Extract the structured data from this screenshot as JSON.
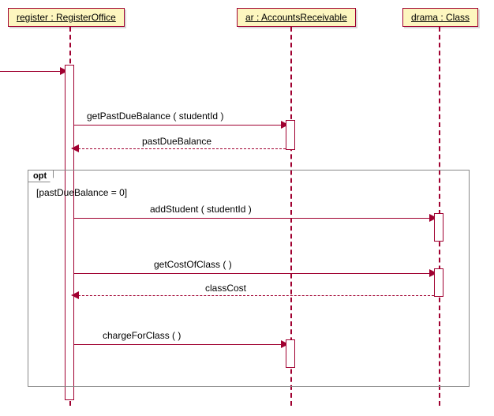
{
  "participants": {
    "register": {
      "label": "register  :  RegisterOffice"
    },
    "ar": {
      "label": "ar  :  AccountsReceivable"
    },
    "drama": {
      "label": "drama  :  Class"
    }
  },
  "fragment": {
    "operator": "opt",
    "guard": "[pastDueBalance = 0]"
  },
  "messages": {
    "m1": {
      "label": "getPastDueBalance ( studentId )"
    },
    "r1": {
      "label": "pastDueBalance"
    },
    "m2": {
      "label": "addStudent ( studentId )"
    },
    "m3": {
      "label": "getCostOfClass  (   )"
    },
    "r3": {
      "label": "classCost"
    },
    "m4": {
      "label": "chargeForClass  (   )"
    }
  },
  "chart_data": {
    "type": "sequence-diagram",
    "participants": [
      {
        "name": "register",
        "type": "RegisterOffice"
      },
      {
        "name": "ar",
        "type": "AccountsReceivable"
      },
      {
        "name": "drama",
        "type": "Class"
      }
    ],
    "incoming_found_message": {
      "to": "register"
    },
    "messages": [
      {
        "from": "register",
        "to": "ar",
        "label": "getPastDueBalance ( studentId )",
        "kind": "sync"
      },
      {
        "from": "ar",
        "to": "register",
        "label": "pastDueBalance",
        "kind": "return"
      }
    ],
    "fragments": [
      {
        "operator": "opt",
        "guard": "[pastDueBalance = 0]",
        "messages": [
          {
            "from": "register",
            "to": "drama",
            "label": "addStudent ( studentId )",
            "kind": "sync"
          },
          {
            "from": "register",
            "to": "drama",
            "label": "getCostOfClass ( )",
            "kind": "sync"
          },
          {
            "from": "drama",
            "to": "register",
            "label": "classCost",
            "kind": "return"
          },
          {
            "from": "register",
            "to": "ar",
            "label": "chargeForClass ( )",
            "kind": "sync"
          }
        ]
      }
    ]
  }
}
